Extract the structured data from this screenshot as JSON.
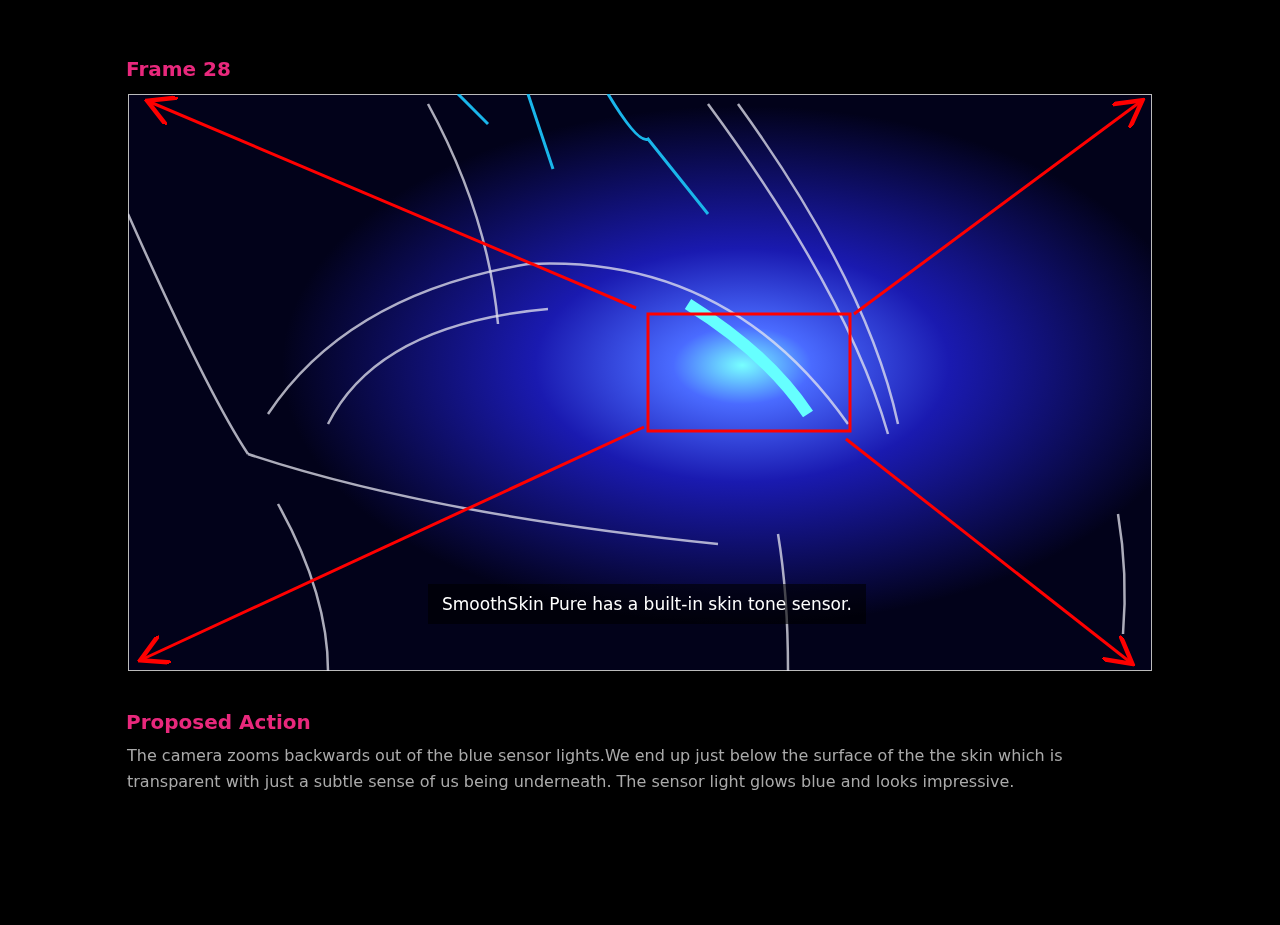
{
  "frame": {
    "title": "Frame 28",
    "caption": "SmoothSkin Pure has a built-in skin tone sensor."
  },
  "action": {
    "heading": "Proposed Action",
    "text": "The camera zooms backwards out of the blue sensor lights.We end up just below the surface of the the skin which is transparent with just a subtle sense of us being underneath. The sensor light glows blue and looks impressive."
  }
}
